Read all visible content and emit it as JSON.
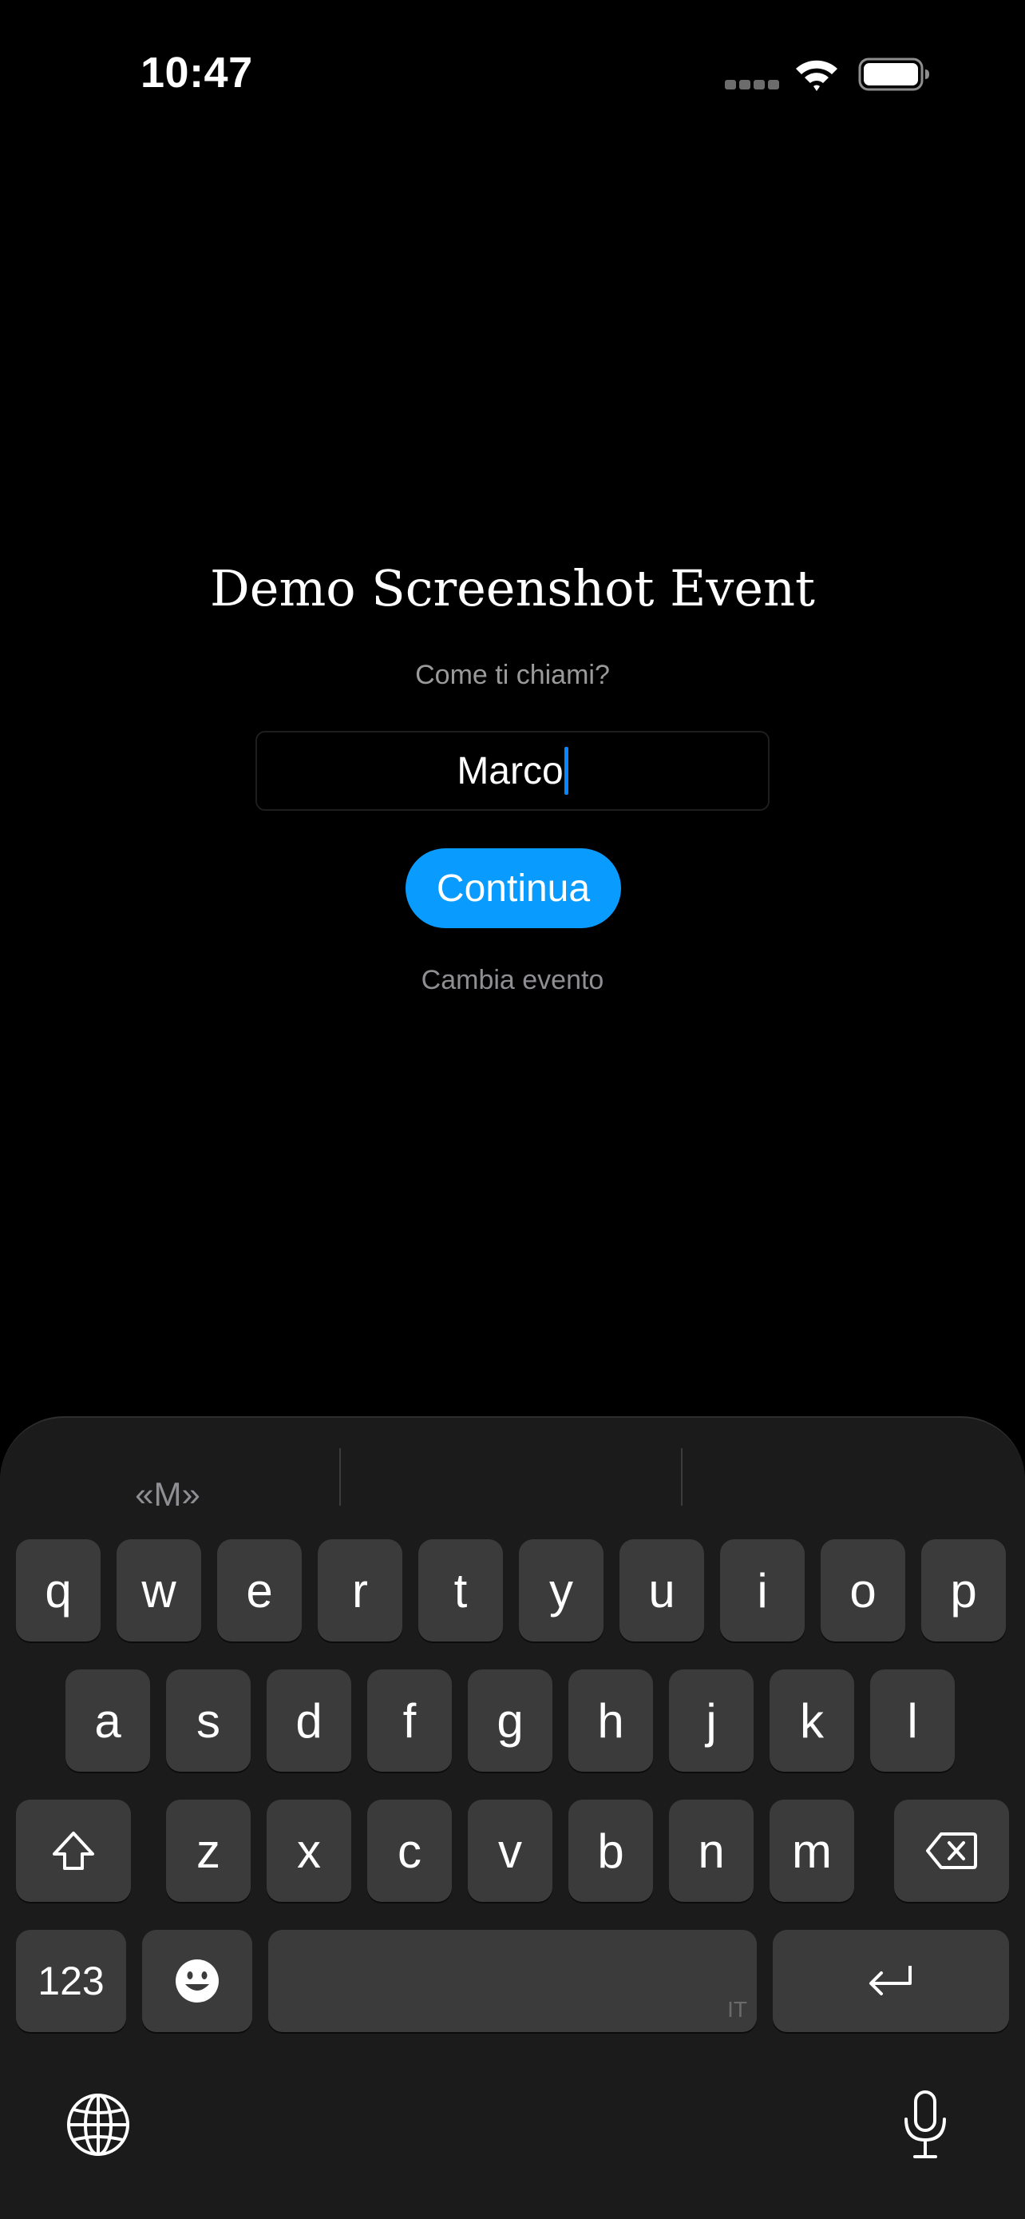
{
  "status_bar": {
    "time": "10:47",
    "signal_icon": "cellular-signal-icon",
    "wifi_icon": "wifi-icon",
    "battery_icon": "battery-icon"
  },
  "login": {
    "event_title": "Demo Screenshot Event",
    "prompt": "Come ti chiami?",
    "name_value": "Marco",
    "continue_label": "Continua",
    "change_event_label": "Cambia evento"
  },
  "keyboard": {
    "suggestions": [
      "«M»",
      "",
      ""
    ],
    "row1": [
      "q",
      "w",
      "e",
      "r",
      "t",
      "y",
      "u",
      "i",
      "o",
      "p"
    ],
    "row2": [
      "a",
      "s",
      "d",
      "f",
      "g",
      "h",
      "j",
      "k",
      "l"
    ],
    "row3": [
      "z",
      "x",
      "c",
      "v",
      "b",
      "n",
      "m"
    ],
    "numbers_label": "123",
    "space_language": "IT",
    "shift_icon": "shift-icon",
    "delete_icon": "delete-icon",
    "emoji_icon": "emoji-icon",
    "return_icon": "return-icon",
    "globe_icon": "globe-icon",
    "mic_icon": "microphone-icon"
  },
  "colors": {
    "background": "#000000",
    "accent": "#0a9bff",
    "caret": "#0a84ff",
    "keyboard_bg": "#1b1b1b",
    "key_bg": "#3b3b3b"
  }
}
